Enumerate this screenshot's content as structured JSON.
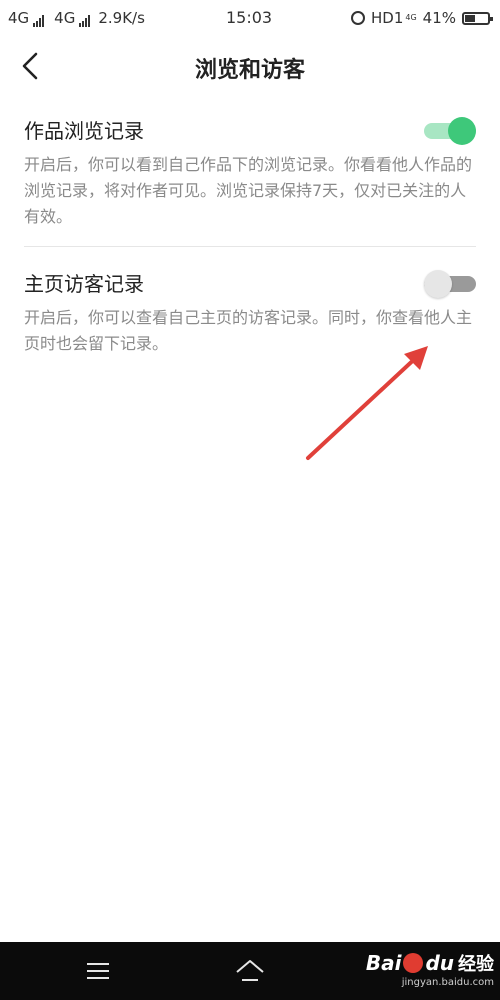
{
  "status_bar": {
    "signal1": "4G",
    "signal2": "4G",
    "speed": "2.9K/s",
    "time": "15:03",
    "hd": "HD1",
    "small_4g": "4G",
    "battery_text": "41%",
    "battery_level": 0.41
  },
  "header": {
    "title": "浏览和访客"
  },
  "settings": [
    {
      "title": "作品浏览记录",
      "description": "开启后，你可以看到自己作品下的浏览记录。你看看他人作品的浏览记录，将对作者可见。浏览记录保持7天，仅对已关注的人有效。",
      "enabled": true
    },
    {
      "title": "主页访客记录",
      "description": "开启后，你可以查看自己主页的访客记录。同时，你查看他人主页时也会留下记录。",
      "enabled": false
    }
  ],
  "colors": {
    "toggle_on": "#3ec87a",
    "toggle_on_track": "#a8e6c3",
    "toggle_off_track": "#9a9a9a",
    "annotation_arrow": "#e0403a"
  },
  "icons": {
    "back": "chevron-left-icon",
    "menu": "menu-icon",
    "home": "home-icon"
  },
  "watermark": {
    "brand_bai": "Bai",
    "brand_du": "du",
    "brand_jingyan": "经验",
    "url": "jingyan.baidu.com"
  }
}
